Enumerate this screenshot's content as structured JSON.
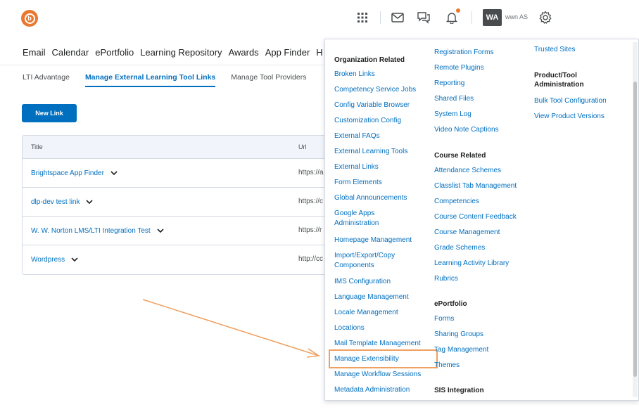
{
  "header": {
    "user_initials": "WA",
    "user_name": "wwn AS",
    "icons": [
      "logo-icon",
      "waffle-icon",
      "mail-icon",
      "chat-icon",
      "bell-icon",
      "gear-icon"
    ]
  },
  "nav": {
    "items": [
      "Email",
      "Calendar",
      "ePortfolio",
      "Learning Repository",
      "Awards",
      "App Finder",
      "H"
    ]
  },
  "tabs": [
    {
      "label": "LTI Advantage"
    },
    {
      "label": "Manage External Learning Tool Links"
    },
    {
      "label": "Manage Tool Providers"
    }
  ],
  "actions": {
    "new_link": "New Link"
  },
  "table": {
    "headers": {
      "title": "Title",
      "url": "Url"
    },
    "rows": [
      {
        "title": "Brightspace App Finder",
        "url": "https://a"
      },
      {
        "title": "dlp-dev test link",
        "url": "https://c"
      },
      {
        "title": "W. W. Norton LMS/LTI Integration Test",
        "url": "https://r"
      },
      {
        "title": "Wordpress",
        "url": "http://cc"
      }
    ]
  },
  "admin_menu": {
    "col1": {
      "heading": "Organization Related",
      "links": [
        "Broken Links",
        "Competency Service Jobs",
        "Config Variable Browser",
        "Customization Config",
        "External FAQs",
        "External Learning Tools",
        "External Links",
        "Form Elements",
        "Global Announcements",
        "Google Apps Administration",
        "Homepage Management",
        "Import/Export/Copy Components",
        "IMS Configuration",
        "Language Management",
        "Locale Management",
        "Locations",
        "Mail Template Management",
        "Manage Extensibility",
        "Manage Workflow Sessions",
        "Metadata Administration"
      ]
    },
    "col2": {
      "top_links": [
        "Registration Forms",
        "Remote Plugins",
        "Reporting",
        "Shared Files",
        "System Log",
        "Video Note Captions"
      ],
      "course_heading": "Course Related",
      "course_links": [
        "Attendance Schemes",
        "Classlist Tab Management",
        "Competencies",
        "Course Content Feedback",
        "Course Management",
        "Grade Schemes",
        "Learning Activity Library",
        "Rubrics"
      ],
      "eportfolio_heading": "ePortfolio",
      "eportfolio_links": [
        "Forms",
        "Sharing Groups",
        "Tag Management",
        "Themes"
      ],
      "sis_heading": "SIS Integration"
    },
    "col3": {
      "top_links": [
        "Trusted Sites"
      ],
      "product_heading": "Product/Tool Administration",
      "product_links": [
        "Bulk Tool Configuration",
        "View Product Versions"
      ]
    }
  },
  "colors": {
    "link": "#006fbf",
    "brand": "#e8792f",
    "highlight": "#f0a060"
  }
}
